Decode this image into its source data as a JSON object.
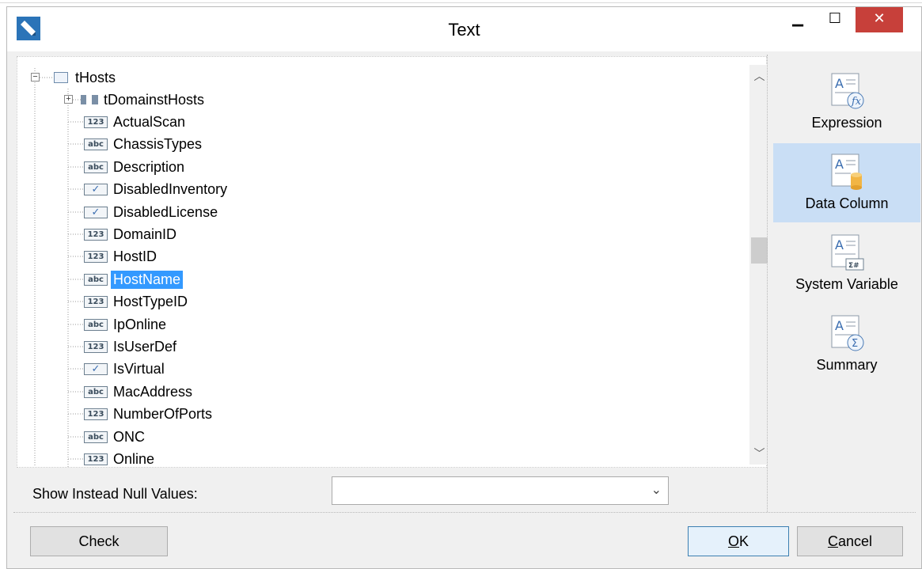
{
  "window": {
    "title": "Text",
    "minimize_glyph": "▁",
    "maximize_glyph": "☐",
    "close_glyph": "✕"
  },
  "tree": {
    "root": {
      "label": "tHosts",
      "expander": "−"
    },
    "child_group": {
      "label": "tDomainstHosts",
      "expander": "+"
    },
    "fields": [
      {
        "type": "123",
        "label": "ActualScan"
      },
      {
        "type": "abc",
        "label": "ChassisTypes"
      },
      {
        "type": "abc",
        "label": "Description"
      },
      {
        "type": "check",
        "label": "DisabledInventory"
      },
      {
        "type": "check",
        "label": "DisabledLicense"
      },
      {
        "type": "123",
        "label": "DomainID"
      },
      {
        "type": "123",
        "label": "HostID"
      },
      {
        "type": "abc",
        "label": "HostName",
        "selected": true
      },
      {
        "type": "123",
        "label": "HostTypeID"
      },
      {
        "type": "abc",
        "label": "IpOnline"
      },
      {
        "type": "123",
        "label": "IsUserDef"
      },
      {
        "type": "check",
        "label": "IsVirtual"
      },
      {
        "type": "abc",
        "label": "MacAddress"
      },
      {
        "type": "123",
        "label": "NumberOfPorts"
      },
      {
        "type": "abc",
        "label": "ONC"
      },
      {
        "type": "123",
        "label": "Online"
      }
    ],
    "type_glyphs": {
      "123": "123",
      "abc": "abc",
      "check": "✓"
    }
  },
  "null_values": {
    "label": "Show Instead Null Values:",
    "value": ""
  },
  "side_panel": {
    "items": [
      {
        "label": "Expression",
        "icon": "expression-icon",
        "active": false
      },
      {
        "label": "Data Column",
        "icon": "data-column-icon",
        "active": true
      },
      {
        "label": "System Variable",
        "icon": "system-variable-icon",
        "active": false
      },
      {
        "label": "Summary",
        "icon": "summary-icon",
        "active": false
      }
    ]
  },
  "buttons": {
    "check": "Check",
    "ok_mnemonic": "O",
    "ok_rest": "K",
    "cancel_mnemonic": "C",
    "cancel_rest": "ancel"
  },
  "colors": {
    "selection": "#3399ff",
    "active_side_item": "#c9def5",
    "close_button": "#c7403a"
  }
}
